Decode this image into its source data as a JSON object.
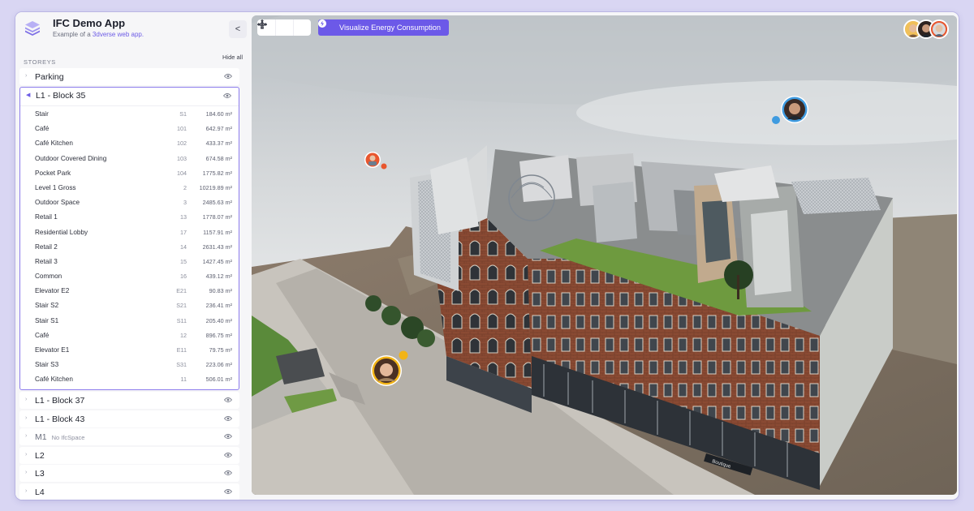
{
  "app": {
    "title": "IFC Demo App",
    "subtitle_prefix": "Example of a ",
    "subtitle_link": "3dverse web app.",
    "collapse_label": "<"
  },
  "storeys": {
    "section_title": "STOREYS",
    "hide_all_label": "Hide all",
    "items_before": [
      {
        "name": "Parking"
      }
    ],
    "expanded": {
      "name": "L1 - Block 35",
      "spaces": [
        {
          "name": "Stair",
          "code": "S1",
          "area": "184.60 m²"
        },
        {
          "name": "Café",
          "code": "101",
          "area": "642.97 m²"
        },
        {
          "name": "Café Kitchen",
          "code": "102",
          "area": "433.37 m²"
        },
        {
          "name": "Outdoor Covered Dining",
          "code": "103",
          "area": "674.58 m²"
        },
        {
          "name": "Pocket Park",
          "code": "104",
          "area": "1775.82 m²"
        },
        {
          "name": "Level 1 Gross",
          "code": "2",
          "area": "10219.89 m²"
        },
        {
          "name": "Outdoor Space",
          "code": "3",
          "area": "2485.63 m²"
        },
        {
          "name": "Retail 1",
          "code": "13",
          "area": "1778.07 m²"
        },
        {
          "name": "Residential Lobby",
          "code": "17",
          "area": "1157.91 m²"
        },
        {
          "name": "Retail 2",
          "code": "14",
          "area": "2631.43 m²"
        },
        {
          "name": "Retail 3",
          "code": "15",
          "area": "1427.45 m²"
        },
        {
          "name": "Common",
          "code": "16",
          "area": "439.12 m²"
        },
        {
          "name": "Elevator E2",
          "code": "E21",
          "area": "90.83 m²"
        },
        {
          "name": "Stair S2",
          "code": "S21",
          "area": "236.41 m²"
        },
        {
          "name": "Stair S1",
          "code": "S11",
          "area": "205.40 m²"
        },
        {
          "name": "Café",
          "code": "12",
          "area": "896.75 m²"
        },
        {
          "name": "Elevator E1",
          "code": "E11",
          "area": "79.75 m²"
        },
        {
          "name": "Stair S3",
          "code": "S31",
          "area": "223.06 m²"
        },
        {
          "name": "Café Kitchen",
          "code": "11",
          "area": "506.01 m²"
        }
      ]
    },
    "items_after": [
      {
        "name": "L1 - Block 37",
        "note": ""
      },
      {
        "name": "L1 - Block 43",
        "note": ""
      },
      {
        "name": "M1",
        "note": "No IfcSpace"
      },
      {
        "name": "L2",
        "note": ""
      },
      {
        "name": "L3",
        "note": ""
      },
      {
        "name": "L4",
        "note": ""
      }
    ]
  },
  "viewport": {
    "visualize_button_label": "Visualize Energy Consumption",
    "tools": [
      "move-icon",
      "fly-icon",
      "more-icon"
    ],
    "shopfront_sign": "Boutique"
  },
  "colors": {
    "accent": "#6c59e8",
    "accent_border": "#8c7cec",
    "cursor_orange": "#e8562e",
    "cursor_blue": "#3f9be0",
    "cursor_yellow": "#f2b417"
  }
}
